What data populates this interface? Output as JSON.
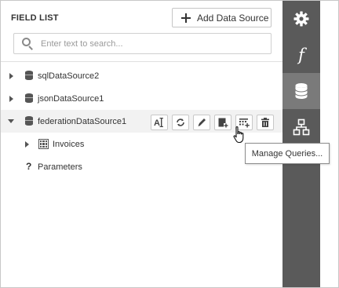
{
  "panel": {
    "title": "FIELD LIST",
    "add_button_label": "Add Data Source",
    "search_placeholder": "Enter text to search..."
  },
  "tree": {
    "items": [
      {
        "label": "sqlDataSource2",
        "type": "data-source",
        "expanded": false
      },
      {
        "label": "jsonDataSource1",
        "type": "data-source",
        "expanded": false
      },
      {
        "label": "federationDataSource1",
        "type": "data-source",
        "expanded": true,
        "selected": true
      },
      {
        "label": "Invoices",
        "type": "table",
        "expanded": false
      },
      {
        "label": "Parameters",
        "type": "parameters"
      }
    ],
    "row_actions": [
      "rename-icon",
      "refresh-icon",
      "edit-icon",
      "add-query-icon",
      "manage-queries-icon",
      "delete-icon"
    ]
  },
  "tooltip": {
    "text": "Manage Queries..."
  },
  "toolbar": {
    "buttons": [
      {
        "icon": "gear-icon",
        "active": false
      },
      {
        "icon": "function-icon",
        "glyph": "f",
        "active": false
      },
      {
        "icon": "database-icon",
        "active": true
      },
      {
        "icon": "hierarchy-icon",
        "active": false
      }
    ]
  },
  "colors": {
    "toolbar_bg": "#5a5a5a",
    "toolbar_active": "#7a7a7a",
    "selected_row": "#f2f2f2",
    "text": "#333333"
  }
}
